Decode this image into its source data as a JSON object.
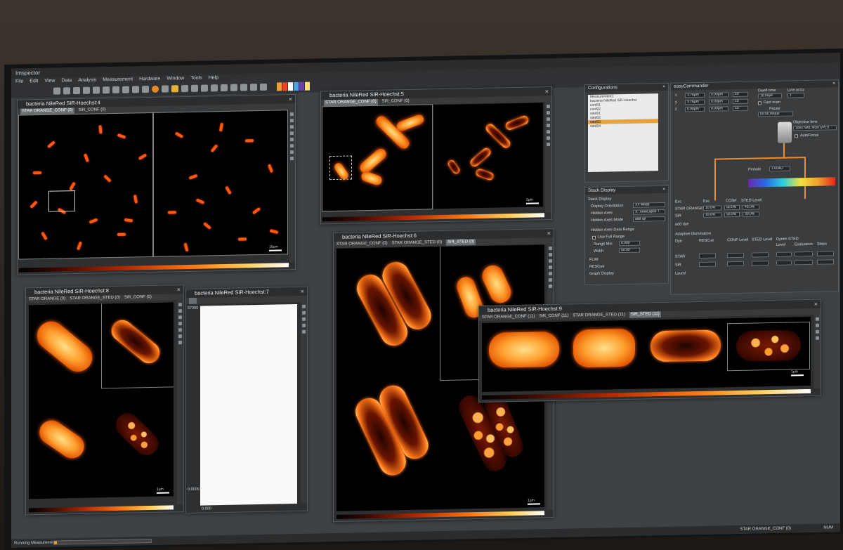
{
  "app": {
    "title": "Imspector",
    "menu": [
      "File",
      "Edit",
      "View",
      "Data",
      "Analysis",
      "Measurement",
      "Hardware",
      "Window",
      "Tools",
      "Help"
    ]
  },
  "windows": {
    "w4": {
      "title": "bacteria NileRed SiR-Hoechst:4",
      "tabs": [
        "STAR ORANGE_CONF (0)",
        "SiR_CONF (0)"
      ],
      "scale": "10µm"
    },
    "w5": {
      "title": "bacteria NileRed SiR-Hoechst:5",
      "tabs": [
        "STAR ORANGE_CONF (0)",
        "SiR_CONF (0)"
      ],
      "scale": "2µm"
    },
    "w6": {
      "title": "bacteria NileRed SiR-Hoechst:6",
      "tabs": [
        "STAR ORANGE_CONF (0)",
        "STAR ORANGE_STED (0)",
        "SiR_STED (0)"
      ],
      "scale": "1µm"
    },
    "w8": {
      "title": "bacteria NileRed SiR-Hoechst:8",
      "tabs": [
        "STAR ORANGE (0)",
        "STAR ORANGE_STED (0)",
        "SiR_CONF (0)"
      ],
      "scale": "1µm"
    },
    "w7": {
      "title": "bacteria NileRed SiR-Hoechst:7",
      "axis_top": "67000",
      "axis_bottom": "0.0000",
      "axis_x": "0.000"
    },
    "w9": {
      "title": "bacteria NileRed SiR-Hoechst:9",
      "tabs": [
        "STAR ORANGE_CONF (11)",
        "SiR_CONF (11)",
        "STAR ORANGE_STED (11)",
        "SiR_STED (11)"
      ],
      "scale": "1µm"
    }
  },
  "configurations": {
    "title": "Configurations",
    "items": [
      "Measurement1",
      "bacteria NileRed SiR-Hoechst",
      "conf01",
      "conf02",
      "sted01",
      "sted02",
      "sted03",
      "sted04"
    ],
    "selected_index": 6
  },
  "stack_display": {
    "title": "Stack Display",
    "rows": [
      {
        "label": "Stack Display",
        "value": ""
      },
      {
        "label": "Display Orientation",
        "value": "XY Mode"
      },
      {
        "label": "Hidden Axes",
        "value": "X: TimeLapse T"
      },
      {
        "label": "Hidden Axes Mode",
        "value": "add up"
      },
      {
        "label": "Hidden Axes Data Range",
        "value": ""
      },
      {
        "label": "Use Full Range",
        "value": ""
      },
      {
        "label": "Range Min",
        "value": "0.000"
      },
      {
        "label": "Width",
        "value": "50.00"
      }
    ],
    "groups": [
      "FLIM",
      "RESCue",
      "Graph Display"
    ]
  },
  "easy_commander": {
    "title": "easyCommander",
    "axes": [
      "x",
      "y",
      "z"
    ],
    "range": [
      "3.76µm",
      "3.76µm",
      "0.00µm"
    ],
    "position": [
      "0.00µm",
      "0.00µm",
      "0.00µm"
    ],
    "pixels": [
      "10",
      "10",
      "10"
    ],
    "dwell_label": "Dwell time",
    "dwell": "10.00µs",
    "line_accu_label": "Line accu",
    "line_accu": "1",
    "fast_scan": "Fast scan",
    "pause_label": "Pause",
    "pause": "00:00.000µs",
    "objective_label": "Objective lens",
    "objective": "100x NA1.4/Oil UPLS",
    "autofocus": "AutoFocus",
    "pinhole_label": "Pinhole",
    "pinhole": "1.00AU",
    "headers": [
      "Exc",
      "Exc",
      "CONF",
      "STED Level"
    ],
    "lasers": [
      {
        "name": "STAR ORANGE",
        "exc": "10.0%",
        "conf": "50.0%",
        "sted": "40.0%"
      },
      {
        "name": "SiR",
        "exc": "10.0%",
        "conf": "50.0%",
        "sted": "30.0%"
      }
    ],
    "add_dye": "add dye",
    "adaptive_label": "Adaptive Illumination",
    "ai_cols": [
      "Dye",
      "RESCue",
      "CONF Level",
      "STED Level",
      "Dymin STED",
      "Level",
      "Evaluation",
      "Steps"
    ],
    "ai_rows": [
      "STAR",
      "SiR"
    ],
    "ai_extra": "Laurel"
  },
  "status": {
    "left": "Running Measurement... [ 3%]",
    "progress": 0.03,
    "right1": "STAR ORANGE_CONF (0)",
    "right2": "NUM"
  },
  "colors": {
    "accent": "#f08a2a",
    "selection": "#e6a53a"
  }
}
